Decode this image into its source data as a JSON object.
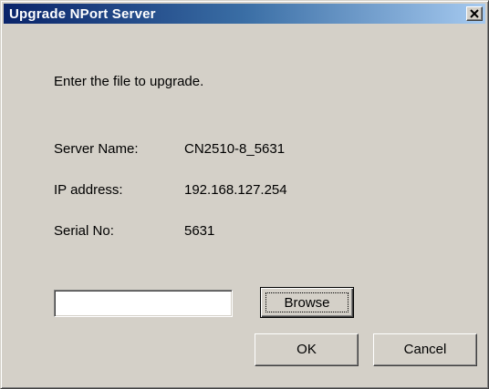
{
  "window": {
    "title": "Upgrade NPort Server"
  },
  "instruction": "Enter the file to upgrade.",
  "fields": {
    "server_name_label": "Server Name:",
    "server_name_value": "CN2510-8_5631",
    "ip_label": "IP address:",
    "ip_value": "192.168.127.254",
    "serial_label": "Serial No:",
    "serial_value": "5631"
  },
  "file_input": {
    "value": "",
    "placeholder": ""
  },
  "buttons": {
    "browse": "Browse",
    "ok": "OK",
    "cancel": "Cancel"
  },
  "icons": {
    "close": "close-icon"
  },
  "colors": {
    "titlebar_start": "#0a246a",
    "titlebar_end": "#a6caf0",
    "dialog_bg": "#d4d0c8"
  }
}
